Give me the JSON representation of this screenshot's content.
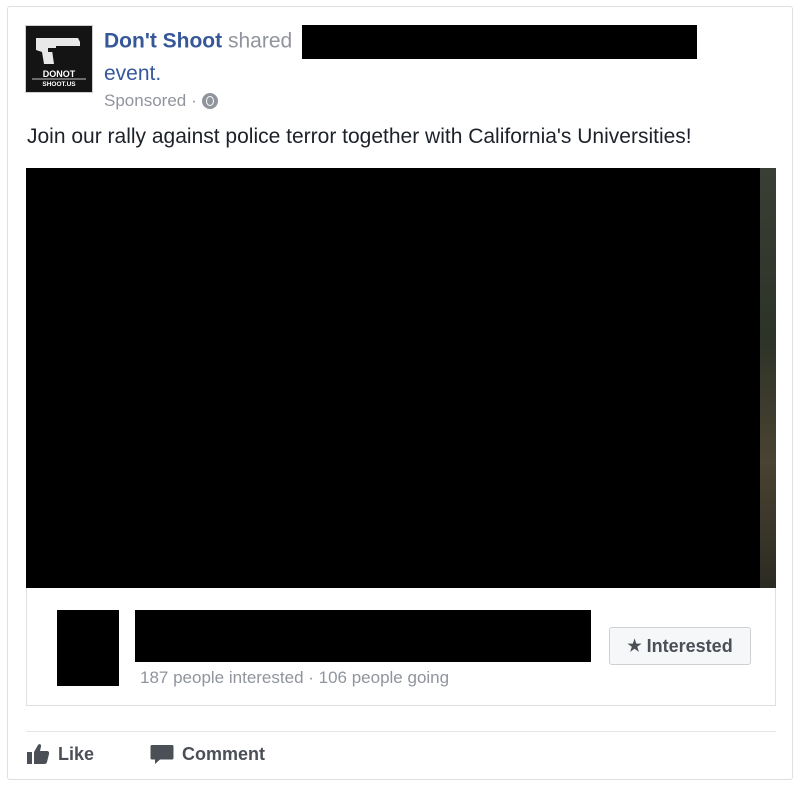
{
  "post": {
    "page_name": "Don't Shoot",
    "shared_text": "shared",
    "event_text": "event.",
    "sponsored": "Sponsored",
    "separator": "·",
    "message": "Join our rally against police terror together with California's Universities!"
  },
  "avatar": {
    "logo_line1": "DONOT",
    "logo_line2": "SHOOT.US"
  },
  "event": {
    "stats": "187 people interested · 106 people going",
    "interested_label": "Interested",
    "interested_icon": "star-icon"
  },
  "actions": {
    "like_label": "Like",
    "like_icon": "thumbs-up-icon",
    "comment_label": "Comment",
    "comment_icon": "speech-bubble-icon"
  },
  "colors": {
    "link": "#365899",
    "secondary_text": "#90949c",
    "button_text": "#4b4f56",
    "redaction": "#000000"
  }
}
